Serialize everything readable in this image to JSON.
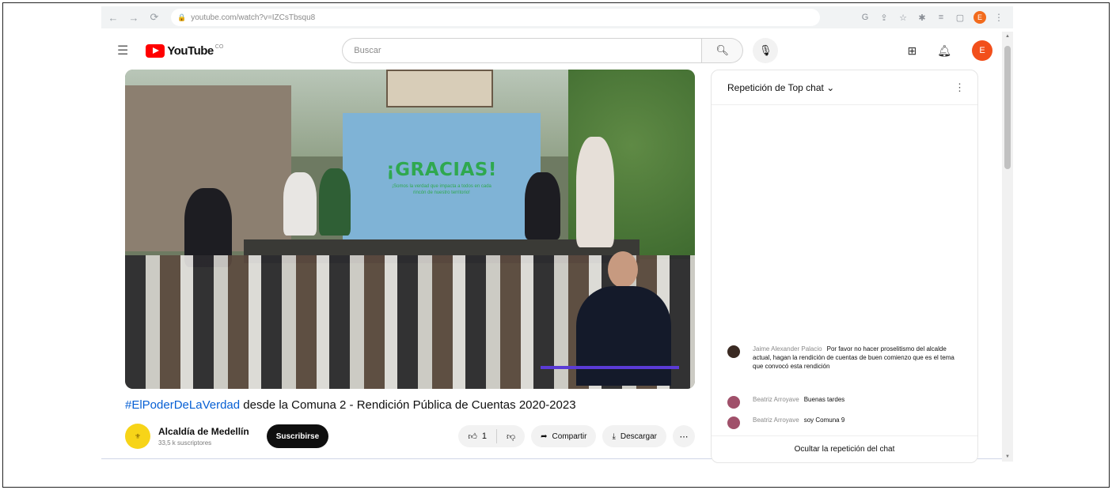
{
  "browser": {
    "url": "youtube.com/watch?v=IZCsTbsqu8",
    "nav": [
      "←",
      "→",
      "⟳"
    ],
    "profile_initial": "E"
  },
  "yt": {
    "logo_text": "YouTube",
    "country": "CO",
    "search_placeholder": "Buscar",
    "avatar_initial": "E"
  },
  "video": {
    "screen_title": "¡GRACIAS!",
    "screen_subtitle": "¡Somos la verdad que impacta a todos en cada rincón de nuestro territorio!",
    "title_hashtag": "#ElPoderDeLaVerdad",
    "title_rest": " desde la Comuna 2 - Rendición Pública de Cuentas 2020-2023"
  },
  "channel": {
    "name": "Alcaldía de Medellín",
    "subscribers": "33,5 k suscriptores",
    "subscribe_label": "Suscribirse"
  },
  "actions": {
    "likes": "1",
    "share_label": "Compartir",
    "download_label": "Descargar"
  },
  "chat": {
    "header": "Repetición de Top chat",
    "messages": [
      {
        "author": "Jaime Alexander Palacio",
        "text": "Por favor no hacer proselitismo del alcalde actual, hagan la rendición de cuentas de buen comienzo que es el tema que convocó esta rendición",
        "color": "#3a2a22"
      },
      {
        "author": "Beatriz Arroyave",
        "text": "Buenas tardes",
        "color": "#a0506a"
      },
      {
        "author": "Beatriz Arroyave",
        "text": "soy Comuna 9",
        "color": "#a0506a"
      }
    ],
    "footer": "Ocultar la repetición del chat"
  },
  "colors": {
    "accent_red": "#ff0000",
    "link_blue": "#065fd4",
    "avatar_orange": "#f24f1b"
  }
}
